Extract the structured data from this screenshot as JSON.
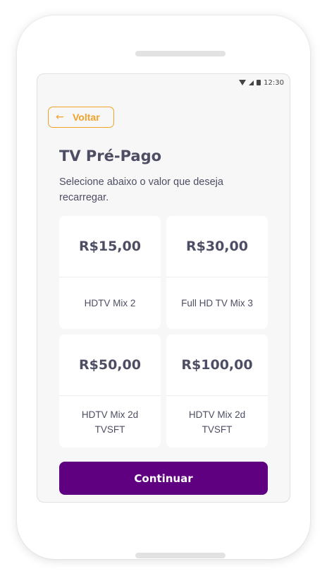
{
  "status_bar": {
    "time": "12:30",
    "icons": [
      "wifi-icon",
      "signal-icon",
      "battery-icon"
    ]
  },
  "back": {
    "label": "Voltar",
    "icon": "arrow-left-icon"
  },
  "header": {
    "title": "TV Pré-Pago",
    "subtitle": "Selecione abaixo o valor que deseja recarregar."
  },
  "options": [
    {
      "price": "R$15,00",
      "plan": "HDTV Mix 2"
    },
    {
      "price": "R$30,00",
      "plan": "Full HD TV Mix 3"
    },
    {
      "price": "R$50,00",
      "plan": "HDTV Mix 2d TVSFT"
    },
    {
      "price": "R$100,00",
      "plan": "HDTV Mix 2d TVSFT"
    }
  ],
  "continue_label": "Continuar",
  "colors": {
    "accent": "#5f0080",
    "back_accent": "#f0a22a",
    "text": "#4d4e63",
    "background": "#f7f7f8"
  }
}
